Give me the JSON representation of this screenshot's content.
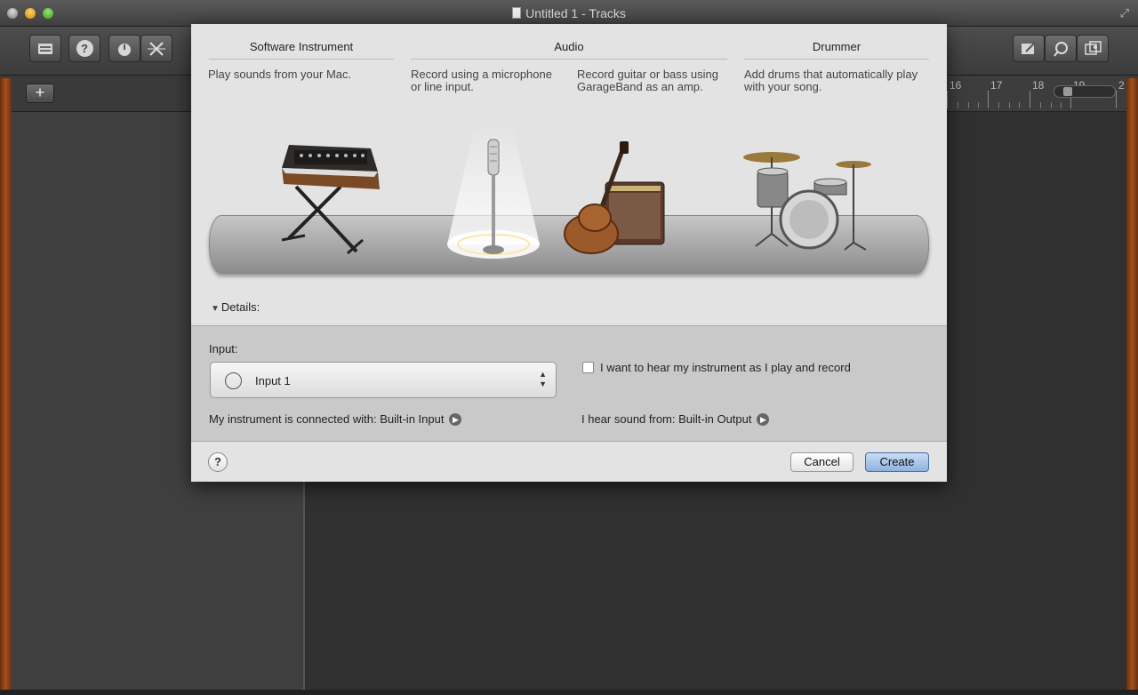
{
  "window": {
    "title": "Untitled 1 - Tracks"
  },
  "toolbar": {
    "left_icons": [
      "library-icon",
      "help-icon",
      "smart-controls-icon",
      "editors-icon"
    ],
    "right_icons": [
      "notepad-icon",
      "loop-browser-icon",
      "media-browser-icon"
    ]
  },
  "tracks": {
    "add_label": "+"
  },
  "ruler": {
    "bars": [
      "16",
      "17",
      "18",
      "19",
      "2"
    ]
  },
  "dialog": {
    "columns": [
      {
        "title": "Software Instrument",
        "desc": "Play sounds from your Mac."
      },
      {
        "title": "Audio",
        "desc_mic": "Record using a microphone or line input.",
        "desc_guitar": "Record guitar or bass using GarageBand as an amp."
      },
      {
        "title": "Drummer",
        "desc": "Add drums that automatically play with your song."
      }
    ],
    "details_label": "Details:",
    "input_label": "Input:",
    "input_value": "Input 1",
    "monitor_label": "I want to hear my instrument as I play and record",
    "monitor_checked": false,
    "connected_label": "My instrument is connected with: Built-in Input",
    "output_label": "I hear sound from: Built-in Output",
    "help_label": "?",
    "cancel_label": "Cancel",
    "create_label": "Create",
    "selected_type": "Audio - microphone"
  }
}
